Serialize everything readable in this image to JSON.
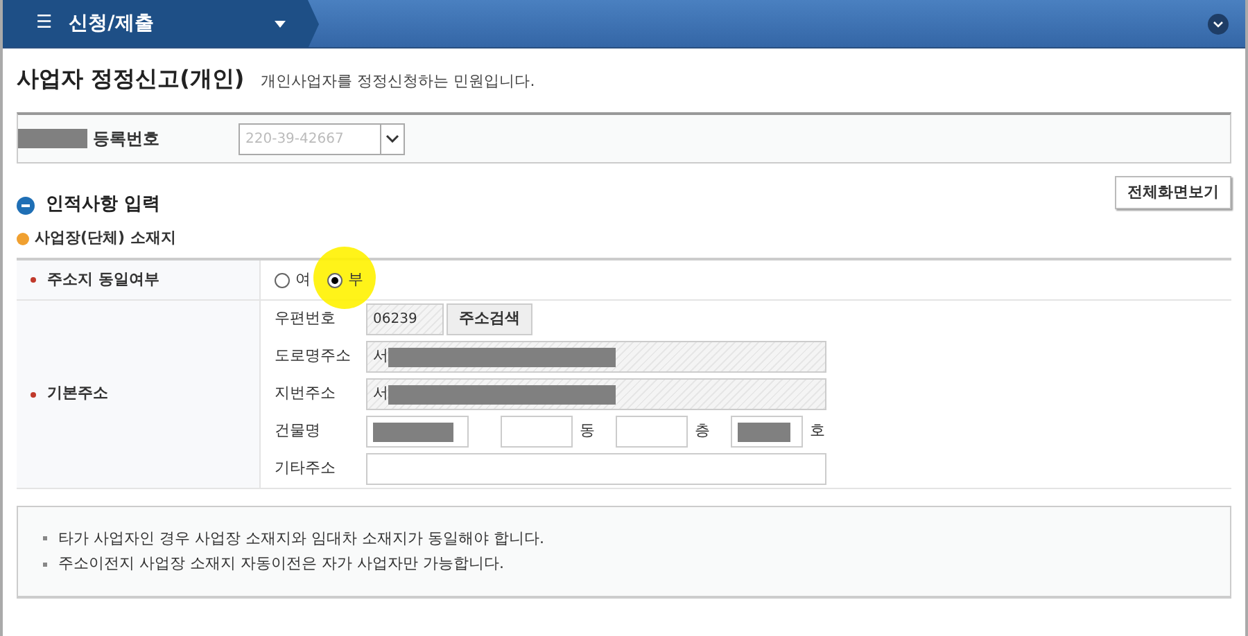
{
  "top_bar": {
    "menu_icon": "☰",
    "title": "신청/제출"
  },
  "page": {
    "title": "사업자 정정신고(개인)",
    "description": "개인사업자를 정정신청하는 민원입니다."
  },
  "business_number": {
    "label": "등록번호",
    "value": "220-39-42667"
  },
  "section": {
    "title": "인적사항 입력",
    "button": "전체화면보기",
    "subtitle": "사업장(단체) 소재지"
  },
  "same_address": {
    "label": "주소지 동일여부",
    "required": true,
    "options": [
      {
        "label": "여",
        "selected": false
      },
      {
        "label": "부",
        "selected": true
      }
    ],
    "highlighted": true
  },
  "base_address": {
    "label": "기본주소",
    "required": true,
    "postal_code": {
      "label": "우편번호",
      "value": "06239",
      "button": "주소검색"
    },
    "road_address": {
      "label": "도로명주소",
      "value": "서"
    },
    "lot_address": {
      "label": "지번주소",
      "value": "서"
    },
    "building": {
      "label": "건물명",
      "dong_unit": "동",
      "floor_unit": "층",
      "ho_unit": "호"
    },
    "other_address": {
      "label": "기타주소"
    }
  },
  "notes": [
    "타가 사업자인 경우 사업장 소재지와 임대차 소재지가 동일해야 합니다.",
    "주소이전지 사업장 소재지 자동이전은 자가 사업자만 가능합니다."
  ]
}
